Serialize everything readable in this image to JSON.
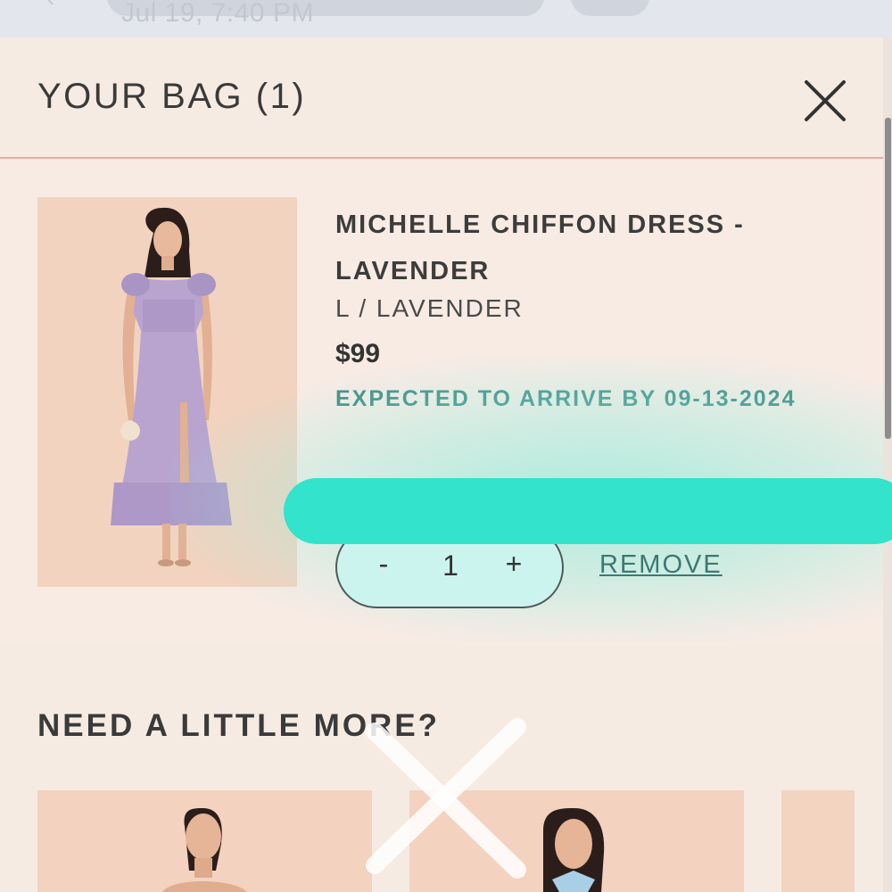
{
  "status_bar": {
    "timestamp": "Jul 19, 7:40 PM"
  },
  "bag": {
    "title": "YOUR BAG (1)",
    "close_icon": "close-icon"
  },
  "item": {
    "name": "MICHELLE CHIFFON DRESS - LAVENDER",
    "variant": "L / LAVENDER",
    "price": "$99",
    "arrival": "EXPECTED TO ARRIVE BY 09-13-2024",
    "quantity": {
      "minus_label": "-",
      "value": "1",
      "plus_label": "+"
    },
    "remove_label": "REMOVE",
    "image_icon": "product-photo"
  },
  "recommendations": {
    "title": "NEED A LITTLE MORE?",
    "count_visible": 3
  },
  "colors": {
    "panel_bg": "#f6ebe3",
    "accent_teal": "#3e8c84",
    "highlight": "#33e3cb",
    "divider": "#e6a9a6",
    "dress_lavender": "#b9a3cf"
  }
}
